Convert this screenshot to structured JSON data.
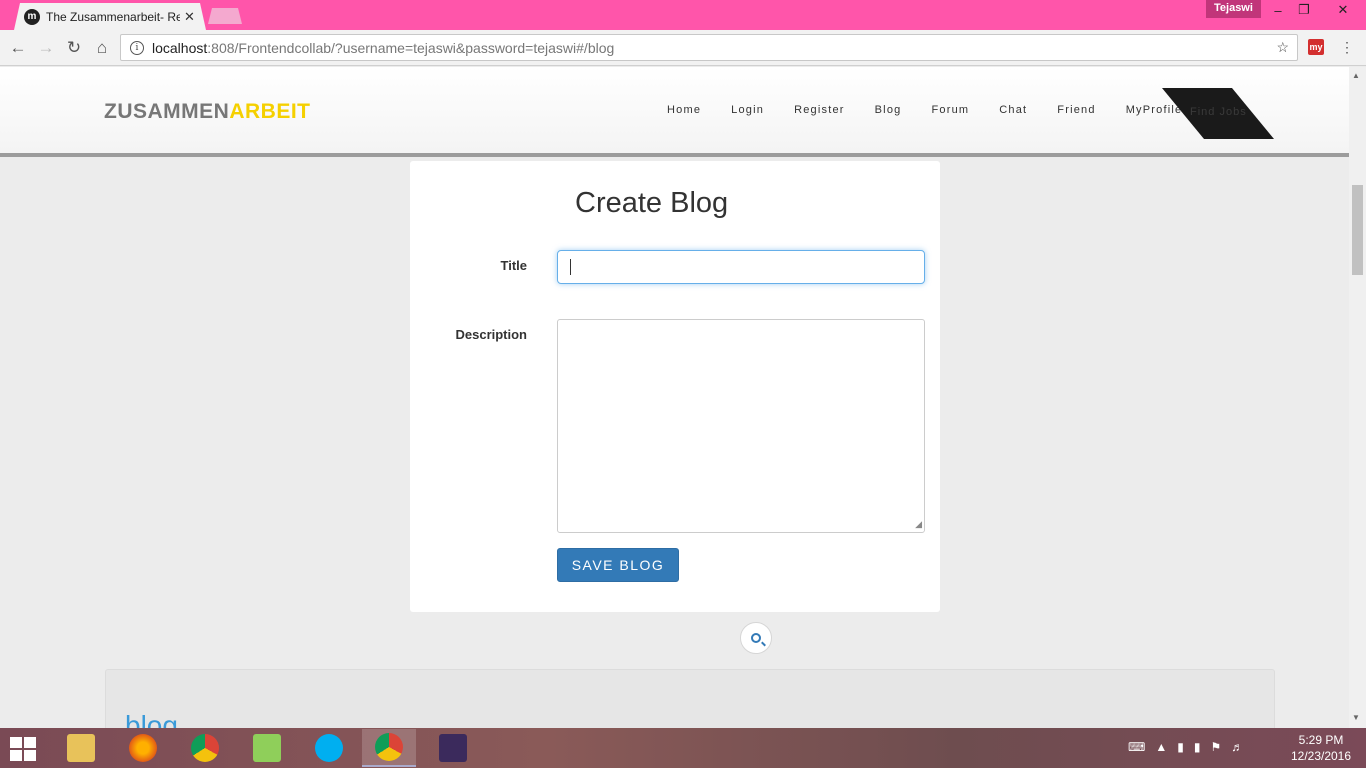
{
  "browser": {
    "tab_title": "The Zusammenarbeit- Re",
    "tab_close": "✕",
    "profile_name": "Tejaswi",
    "url_host": "localhost",
    "url_rest": ":808/Frontendcollab/?username=tejaswi&password=tejaswi#/blog",
    "window_min": "–",
    "window_restore": "❐",
    "window_close": "✕"
  },
  "site": {
    "brand_part1": "ZUSAMMEN",
    "brand_part2": "ARBEIT",
    "nav": [
      "Home",
      "Login",
      "Register",
      "Blog",
      "Forum",
      "Chat",
      "Friend",
      "MyProfile"
    ],
    "find_jobs": "Find Jobs"
  },
  "form": {
    "heading": "Create Blog",
    "title_label": "Title",
    "title_value": "",
    "description_label": "Description",
    "description_value": "",
    "save_label": "SAVE BLOG"
  },
  "blog_section": {
    "heading": "blog"
  },
  "taskbar": {
    "apps": [
      "file-explorer-icon",
      "firefox-icon",
      "chrome-icon",
      "notepad-plus-plus-icon",
      "skype-icon",
      "chrome-icon",
      "java-ee-ide-icon"
    ],
    "time": "5:29 PM",
    "date": "12/23/2016"
  },
  "colors": {
    "titlebar": "#ff55aa",
    "brand_gray": "#777777",
    "brand_yellow": "#f5d000",
    "primary_button": "#337ab7",
    "blog_heading": "#3a9ad9"
  }
}
